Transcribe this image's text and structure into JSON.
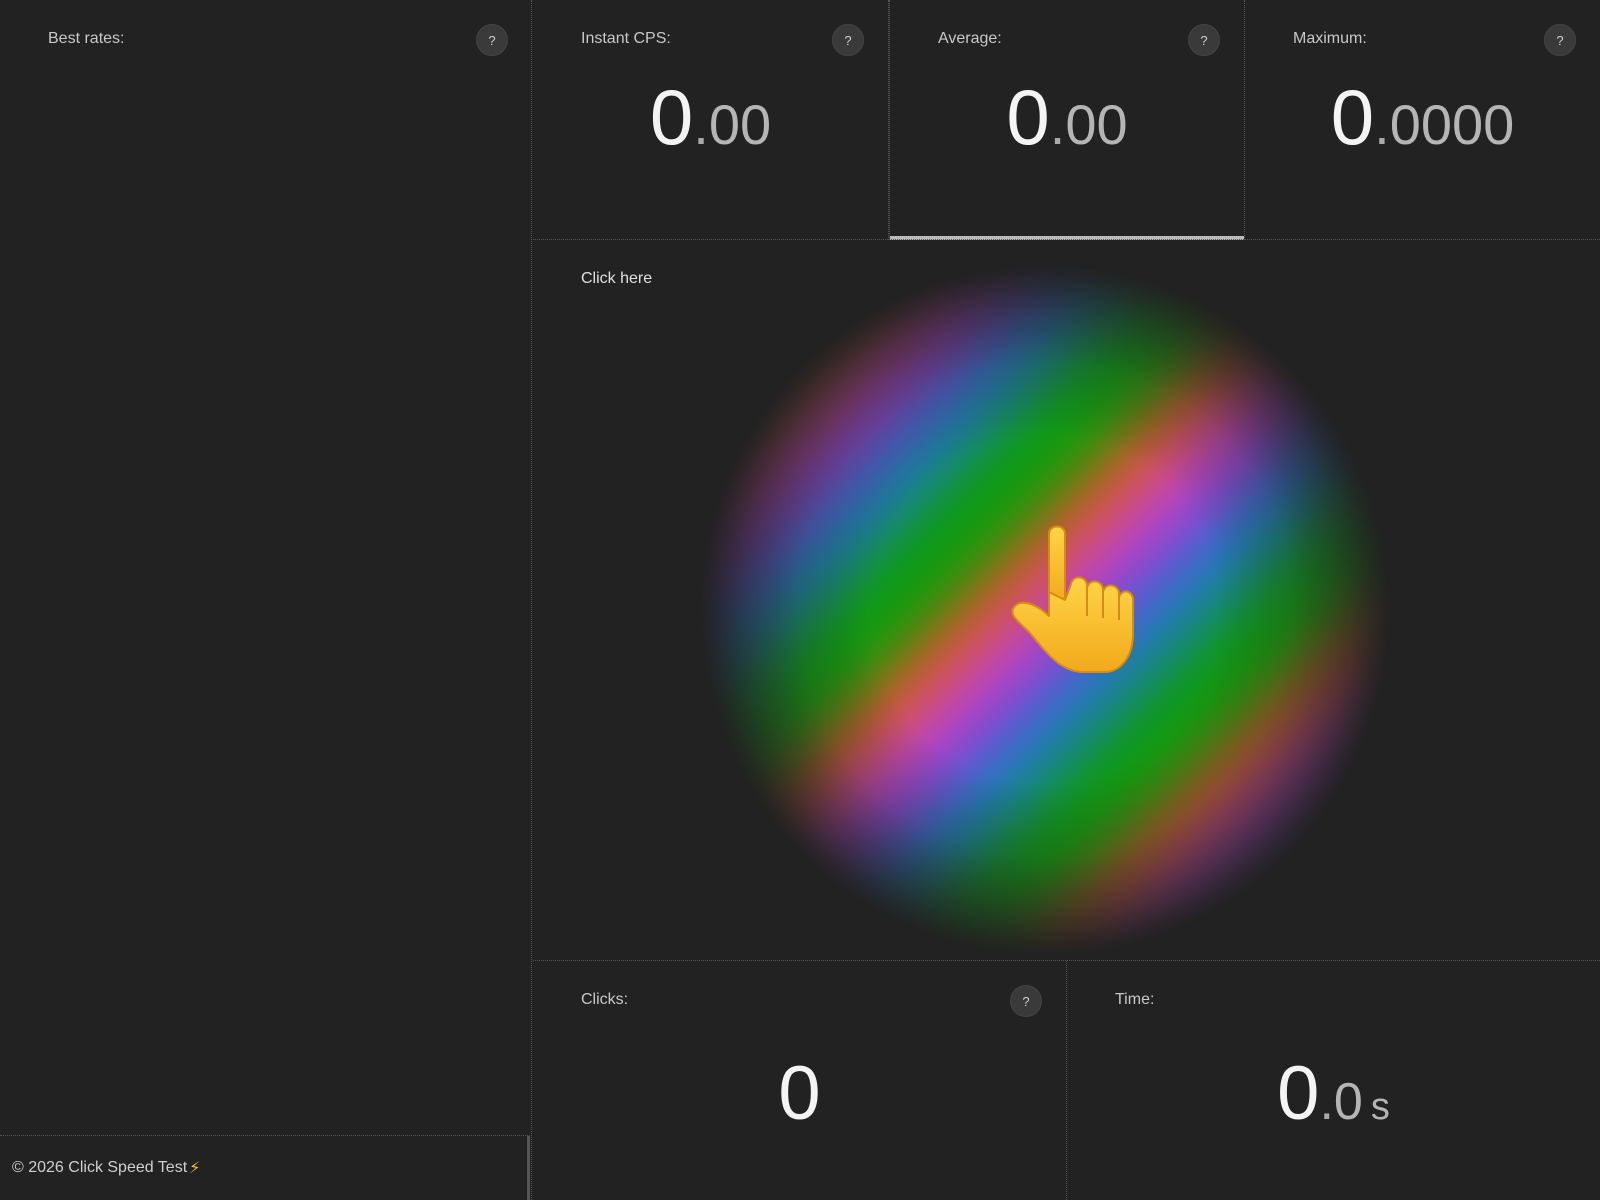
{
  "sidebar": {
    "label": "Best rates:",
    "help": "?"
  },
  "stats": {
    "instant": {
      "label": "Instant CPS:",
      "int": "0",
      "dot": ".",
      "dec": "00",
      "help": "?"
    },
    "average": {
      "label": "Average:",
      "int": "0",
      "dot": ".",
      "dec": "00",
      "help": "?"
    },
    "maximum": {
      "label": "Maximum:",
      "int": "0",
      "dot": ".",
      "dec": "0000",
      "help": "?"
    }
  },
  "click_area": {
    "label": "Click here",
    "icon": "pointing-hand-icon"
  },
  "bottom": {
    "clicks": {
      "label": "Clicks:",
      "value": "0",
      "help": "?"
    },
    "time": {
      "label": "Time:",
      "int": "0",
      "dot": ".",
      "dec": "0",
      "unit": "s"
    }
  },
  "footer": {
    "text": "© 2026 Click Speed Test",
    "icon": "⚡"
  },
  "colors": {
    "background": "#222222",
    "text": "#cfcfcf",
    "bolt": "#f5c518",
    "hand": "#fdbf2d"
  }
}
